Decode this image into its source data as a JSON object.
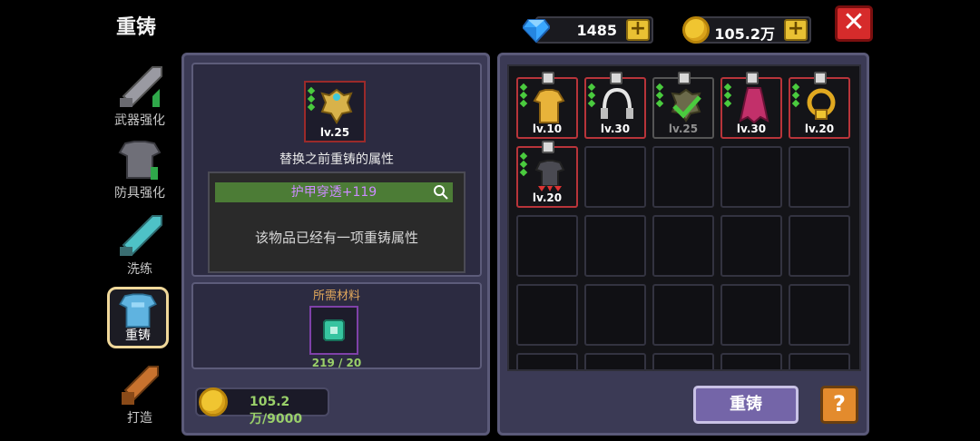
{
  "header": {
    "title": "重铸"
  },
  "currency": {
    "gems": {
      "value": "1485",
      "icon": "diamond-icon"
    },
    "gold": {
      "value": "105.2万",
      "icon": "gold-coin-icon"
    },
    "plus_label": "+"
  },
  "close_label": "✕",
  "nav": {
    "items": [
      {
        "label": "武器强化",
        "icon": "sword-upgrade-icon"
      },
      {
        "label": "防具强化",
        "icon": "armor-upgrade-icon"
      },
      {
        "label": "洗练",
        "icon": "refine-icon"
      },
      {
        "label": "重铸",
        "icon": "reforge-icon",
        "active": true
      },
      {
        "label": "打造",
        "icon": "forge-icon"
      }
    ]
  },
  "selected": {
    "level": "lv.25",
    "heading": "替换之前重铸的属性",
    "attribute": "护甲穿透+119",
    "notice": "该物品已经有一项重铸属性"
  },
  "materials": {
    "title": "所需材料",
    "count": "219 / 20"
  },
  "cost": {
    "value": "105.2万/9000"
  },
  "inventory": {
    "items": [
      {
        "level": "lv.10",
        "icon": "yellow-robe-icon",
        "dim": false
      },
      {
        "level": "lv.30",
        "icon": "headphones-icon",
        "dim": false
      },
      {
        "level": "lv.25",
        "icon": "selected-checkmark-icon",
        "dim": true
      },
      {
        "level": "lv.30",
        "icon": "red-cape-icon",
        "dim": false
      },
      {
        "level": "lv.20",
        "icon": "gold-ring-icon",
        "dim": false
      },
      {
        "level": "lv.20",
        "icon": "spiked-armor-icon",
        "dim": false
      }
    ]
  },
  "actions": {
    "reforge_label": "重铸",
    "help_label": "?"
  },
  "colors": {
    "accent_gold": "#e9c133",
    "close_red": "#d62b2b",
    "attr_purple": "#cc8cff"
  }
}
